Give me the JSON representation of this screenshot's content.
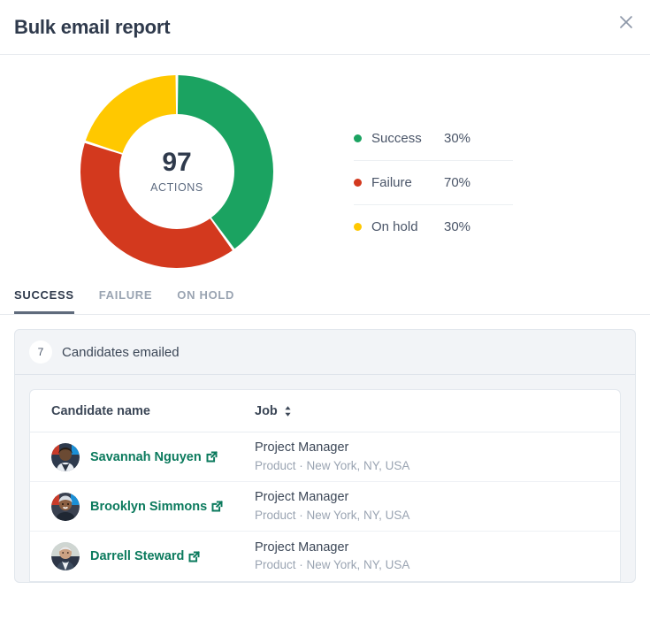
{
  "header": {
    "title": "Bulk email report",
    "close_icon": "close-icon"
  },
  "chart_data": {
    "type": "pie",
    "variant": "donut",
    "title": "Bulk email report",
    "center_value": "97",
    "center_label": "ACTIONS",
    "categories": [
      "Success",
      "Failure",
      "On hold"
    ],
    "values": [
      40,
      40,
      20
    ],
    "display_labels": [
      "30%",
      "70%",
      "30%"
    ],
    "colors": [
      "#1ba361",
      "#d3391e",
      "#ffc800"
    ],
    "legend_position": "right",
    "start_angle": 0,
    "direction": "clockwise",
    "legend": [
      {
        "name": "Success",
        "percent": "30%",
        "color": "#1ba361"
      },
      {
        "name": "Failure",
        "percent": "70%",
        "color": "#d3391e"
      },
      {
        "name": "On hold",
        "percent": "30%",
        "color": "#ffc800"
      }
    ]
  },
  "tabs": [
    {
      "label": "SUCCESS",
      "active": true
    },
    {
      "label": "FAILURE",
      "active": false
    },
    {
      "label": "ON HOLD",
      "active": false
    }
  ],
  "panel": {
    "count": "7",
    "title": "Candidates emailed"
  },
  "table": {
    "columns": [
      {
        "label": "Candidate name",
        "sortable": false
      },
      {
        "label": "Job",
        "sortable": true,
        "sort_icon": "sort-chevrons-icon"
      }
    ],
    "rows": [
      {
        "name": "Savannah Nguyen",
        "link_icon": "external-link-icon",
        "job_title": "Project Manager",
        "job_sub": "Product · New York, NY, USA"
      },
      {
        "name": "Brooklyn Simmons",
        "link_icon": "external-link-icon",
        "job_title": "Project Manager",
        "job_sub": "Product · New York, NY, USA"
      },
      {
        "name": "Darrell Steward",
        "link_icon": "external-link-icon",
        "job_title": "Project Manager",
        "job_sub": "Product · New York, NY, USA"
      }
    ]
  },
  "colors": {
    "success": "#1ba361",
    "failure": "#d3391e",
    "onhold": "#ffc800",
    "link": "#0b7a5d",
    "text": "#3c4757",
    "muted": "#9aa4b2"
  }
}
